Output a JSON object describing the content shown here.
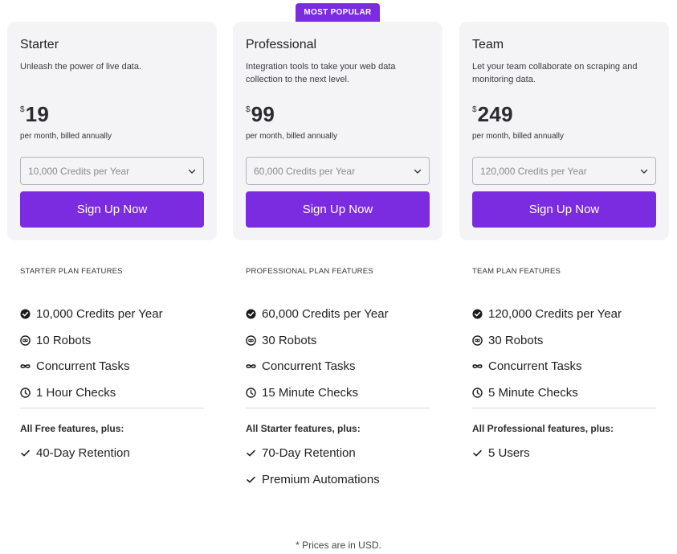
{
  "badge": "MOST POPULAR",
  "plans": [
    {
      "name": "Starter",
      "description": "Unleash the power of live data.",
      "currency": "$",
      "price": "19",
      "billing": "per month, billed annually",
      "credits_select": "10,000 Credits per Year",
      "signup_label": "Sign Up Now",
      "features_heading": "STARTER PLAN FEATURES",
      "features": [
        {
          "icon": "check-circle-icon",
          "text": "10,000 Credits per Year"
        },
        {
          "icon": "robot-icon",
          "text": "10 Robots"
        },
        {
          "icon": "infinity-icon",
          "text": "Concurrent Tasks"
        },
        {
          "icon": "clock-icon",
          "text": "1 Hour Checks"
        }
      ],
      "plus_heading": "All Free features, plus:",
      "extras": [
        "40-Day Retention"
      ]
    },
    {
      "name": "Professional",
      "description": "Integration tools to take your web data collection to the next level.",
      "currency": "$",
      "price": "99",
      "billing": "per month, billed annually",
      "credits_select": "60,000 Credits per Year",
      "signup_label": "Sign Up Now",
      "features_heading": "PROFESSIONAL PLAN FEATURES",
      "features": [
        {
          "icon": "check-circle-icon",
          "text": "60,000 Credits per Year"
        },
        {
          "icon": "robot-icon",
          "text": "30 Robots"
        },
        {
          "icon": "infinity-icon",
          "text": "Concurrent Tasks"
        },
        {
          "icon": "clock-icon",
          "text": "15 Minute Checks"
        }
      ],
      "plus_heading": "All Starter features, plus:",
      "extras": [
        "70-Day Retention",
        "Premium Automations"
      ]
    },
    {
      "name": "Team",
      "description": "Let your team collaborate on scraping and monitoring data.",
      "currency": "$",
      "price": "249",
      "billing": "per month, billed annually",
      "credits_select": "120,000 Credits per Year",
      "signup_label": "Sign Up Now",
      "features_heading": "TEAM PLAN FEATURES",
      "features": [
        {
          "icon": "check-circle-icon",
          "text": "120,000 Credits per Year"
        },
        {
          "icon": "robot-icon",
          "text": "30 Robots"
        },
        {
          "icon": "infinity-icon",
          "text": "Concurrent Tasks"
        },
        {
          "icon": "clock-icon",
          "text": "5 Minute Checks"
        }
      ],
      "plus_heading": "All Professional features, plus:",
      "extras": [
        "5 Users"
      ]
    }
  ],
  "footnote": "* Prices are in USD.",
  "colors": {
    "accent": "#7c2ce0",
    "card_bg": "#f4f4f6"
  }
}
